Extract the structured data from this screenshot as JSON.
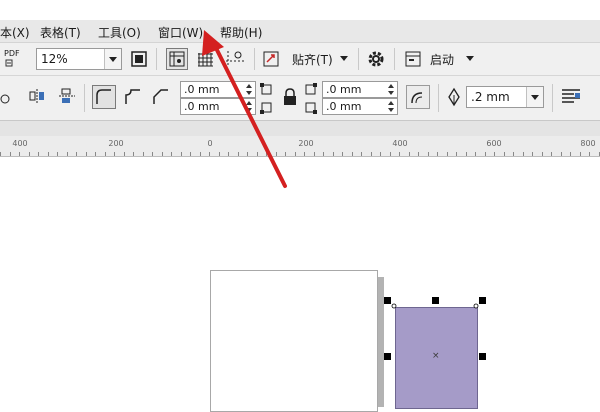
{
  "menubar": {
    "items": [
      {
        "label": "本(X)"
      },
      {
        "label": "表格(T)"
      },
      {
        "label": "工具(O)"
      },
      {
        "label": "窗口(W)"
      },
      {
        "label": "帮助(H)"
      }
    ]
  },
  "toolbar1": {
    "pdf_label": "PDF",
    "zoom_value": "12%",
    "snap_label": "贴齐(T)",
    "launch_label": "启动"
  },
  "toolbar2": {
    "corner1_value": ".0 mm",
    "corner2_value": ".0 mm",
    "corner3_value": ".0 mm",
    "corner4_value": ".0 mm",
    "outline_width_value": ".2 mm"
  },
  "ruler": {
    "labels": [
      "400",
      "200",
      "0",
      "200",
      "400",
      "600",
      "800"
    ]
  },
  "canvas": {
    "rect_fill": "#a59bc8",
    "center_mark": "×"
  },
  "annotation": {
    "arrow_color": "#d42020"
  }
}
